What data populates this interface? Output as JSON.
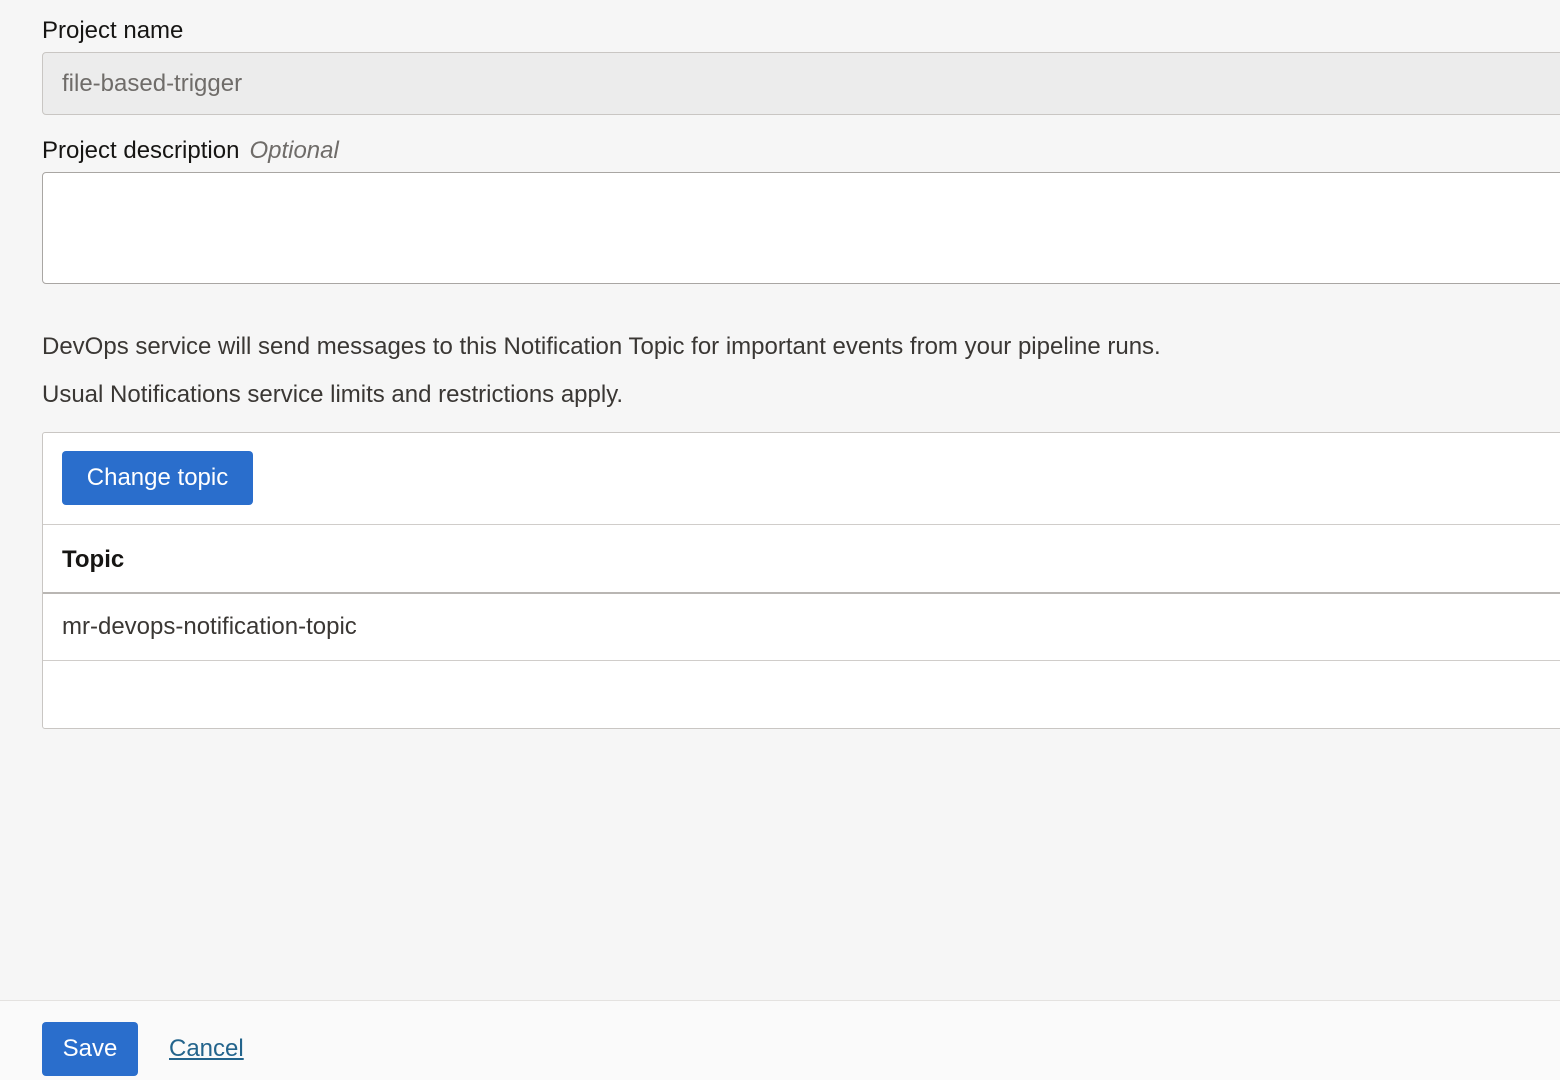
{
  "form": {
    "project_name_label": "Project name",
    "project_name_value": "file-based-trigger",
    "project_description_label": "Project description",
    "project_description_optional": "Optional",
    "project_description_value": ""
  },
  "notification": {
    "info_line_1": "DevOps service will send messages to this Notification Topic for important events from your pipeline runs.",
    "info_line_2": "Usual Notifications service limits and restrictions apply.",
    "change_topic_label": "Change topic",
    "table": {
      "columns": [
        "Topic"
      ],
      "rows": [
        [
          "mr-devops-notification-topic"
        ]
      ]
    }
  },
  "footer": {
    "save_label": "Save",
    "cancel_label": "Cancel"
  },
  "colors": {
    "primary": "#2a6ecc",
    "link": "#23648c",
    "background": "#f6f6f6"
  }
}
